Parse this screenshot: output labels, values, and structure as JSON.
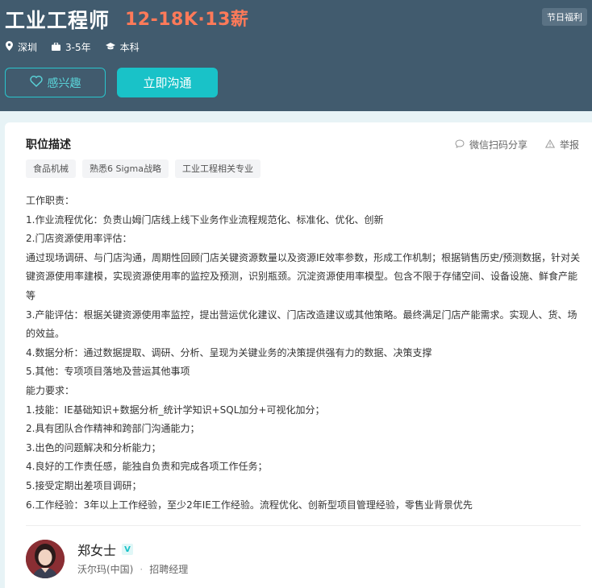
{
  "job": {
    "title": "工业工程师",
    "salary": "12-18K·13薪",
    "badge": "节日福利",
    "location": "深圳",
    "experience": "3-5年",
    "education": "本科"
  },
  "buttons": {
    "interest": "感兴趣",
    "chat": "立即沟通"
  },
  "section": {
    "title": "职位描述",
    "share": "微信扫码分享",
    "report": "举报"
  },
  "tags": [
    "食品机械",
    "熟悉6 Sigma战略",
    "工业工程相关专业"
  ],
  "description": [
    "工作职责：",
    "1.作业流程优化：负责山姆门店线上线下业务作业流程规范化、标准化、优化、创新",
    "2.门店资源使用率评估：",
    "通过现场调研、与门店沟通，周期性回顾门店关键资源数量以及资源IE效率参数，形成工作机制；根据销售历史/预测数据，针对关键资源使用率建模，实现资源使用率的监控及预测，识别瓶颈。沉淀资源使用率模型。包含不限于存储空间、设备设施、鲜食产能等",
    "3.产能评估：根据关键资源使用率监控，提出营运优化建议、门店改造建议或其他策略。最终满足门店产能需求。实现人、货、场的效益。",
    "4.数据分析：通过数据提取、调研、分析、呈现为关键业务的决策提供强有力的数据、决策支撑",
    "5.其他：专项项目落地及营运其他事项",
    "能力要求：",
    "1.技能：IE基础知识+数据分析_统计学知识+SQL加分+可视化加分；",
    "2.具有团队合作精神和跨部门沟通能力；",
    "3.出色的问题解决和分析能力；",
    "4.良好的工作责任感，能独自负责和完成各项工作任务；",
    "5.接受定期出差项目调研；",
    "6.工作经验：3年以上工作经验，至少2年IE工作经验。流程优化、创新型项目管理经验，零售业背景优先"
  ],
  "recruiter": {
    "name": "郑女士",
    "verify_mark": "V",
    "company": "沃尔玛(中国)",
    "separator": "·",
    "role": "招聘经理"
  }
}
